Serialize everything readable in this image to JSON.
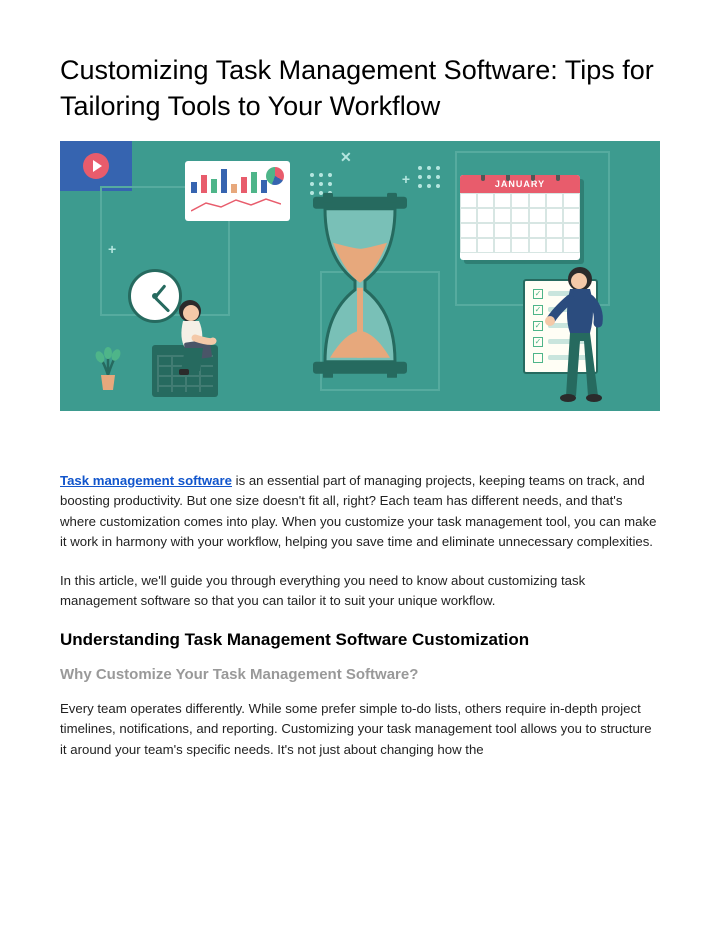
{
  "title": "Customizing Task Management Software: Tips for Tailoring Tools to Your Workflow",
  "hero": {
    "calendar_month": "JANUARY"
  },
  "intro": {
    "link_text": "Task management software",
    "para1_after_link": " is an essential part of managing projects, keeping teams on track, and boosting productivity. But one size doesn't fit all, right? Each team has different needs, and that's where customization comes into play. When you customize your task management tool, you can make it work in harmony with your workflow, helping you save time and eliminate unnecessary complexities.",
    "para2": "In this article, we'll guide you through everything you need to know about customizing task management software so that you can tailor it to suit your unique workflow."
  },
  "section1": {
    "heading": "Understanding Task Management Software Customization",
    "subheading": "Why Customize Your Task Management Software?",
    "para1": "Every team operates differently. While some prefer simple to-do lists, others require in-depth project timelines, notifications, and reporting. Customizing your task management tool allows you to structure it around your team's specific needs. It's not just about changing how the"
  }
}
